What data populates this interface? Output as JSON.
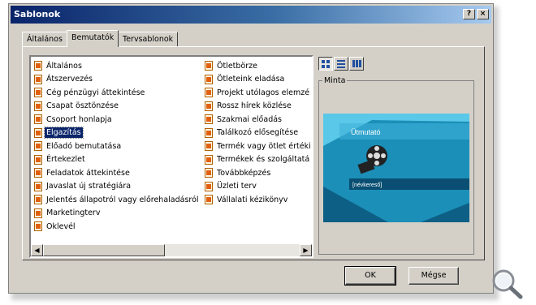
{
  "window": {
    "title": "Sablonok",
    "help_btn": "?",
    "close_btn": "×"
  },
  "tabs": [
    {
      "label": "Általános"
    },
    {
      "label": "Bemutatók"
    },
    {
      "label": "Tervsablonok"
    }
  ],
  "templates": {
    "column1": [
      "Általános",
      "Átszervezés",
      "Cég pénzügyi áttekintése",
      "Csapat ösztönzése",
      "Csoport honlapja",
      "Elgazítás",
      "Előadó bemutatása",
      "Értekezlet",
      "Feladatok áttekintése",
      "Javaslat új stratégiára",
      "Jelentés állapotról vagy előrehaladásról",
      "Marketingterv",
      "Oklevél"
    ],
    "column2": [
      "Ötletbörze",
      "Ötleteink eladása",
      "Projekt utólagos elemzé",
      "Rossz hírek közlése",
      "Szakmai előadás",
      "Találkozó elősegítése",
      "Termék vagy ötlet értéki",
      "Termékek és szolgáltatá",
      "Továbbképzés",
      "Üzleti terv",
      "Vállalati kézikönyv"
    ],
    "selected": "Elgazítás"
  },
  "preview": {
    "legend": "Minta",
    "slide_title": "Ütmutató",
    "slide_subtitle": "[névkereső]"
  },
  "buttons": {
    "ok": "OK",
    "cancel": "Mégse"
  },
  "icons": {
    "template_item": "template-doc-icon",
    "view_large": "large-icons-view-icon",
    "view_list": "list-view-icon",
    "view_details": "details-view-icon",
    "zoom": "magnifier-icon"
  },
  "colors": {
    "titlebar": "#0a246a",
    "selection": "#0a246a",
    "preview_bg": "#1b8fb8"
  }
}
